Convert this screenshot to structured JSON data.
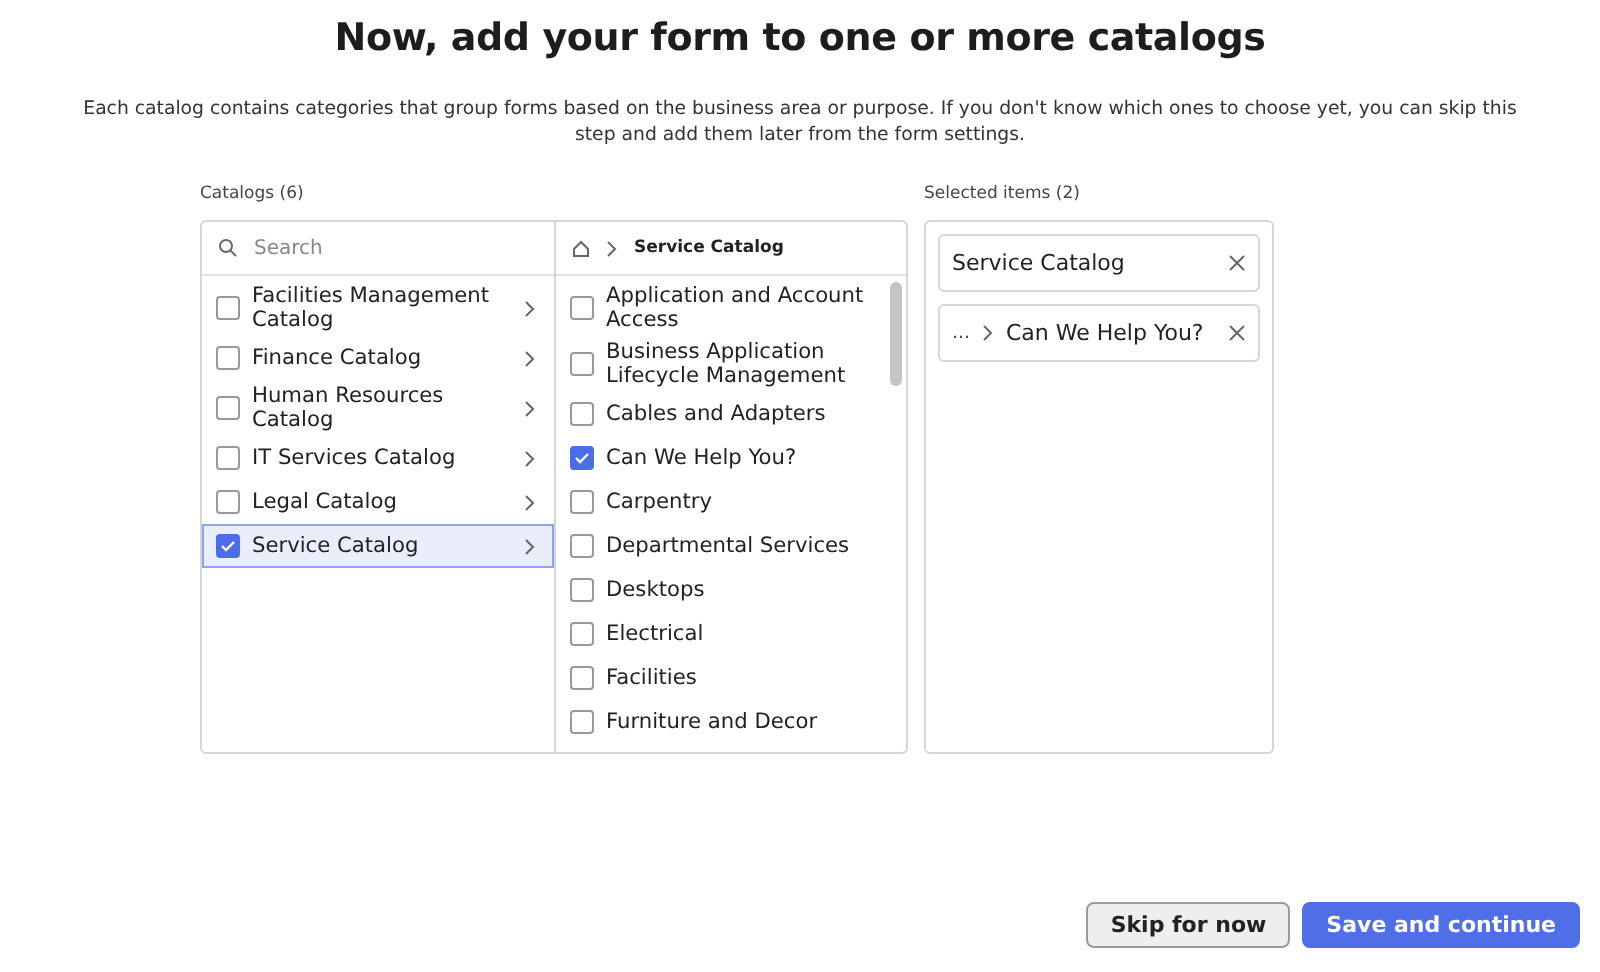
{
  "title": "Now, add your form to one or more catalogs",
  "description": "Each catalog contains categories that group forms based on the business area or purpose. If you don't know which ones to choose yet, you can skip this step and add them later from the form settings.",
  "catalogs": {
    "label": "Catalogs (6)",
    "search": {
      "placeholder": "Search"
    },
    "items": [
      {
        "label": "Facilities Management Catalog",
        "checked": false,
        "selected": false
      },
      {
        "label": "Finance Catalog",
        "checked": false,
        "selected": false
      },
      {
        "label": "Human Resources Catalog",
        "checked": false,
        "selected": false
      },
      {
        "label": "IT Services Catalog",
        "checked": false,
        "selected": false
      },
      {
        "label": "Legal Catalog",
        "checked": false,
        "selected": false
      },
      {
        "label": "Service Catalog",
        "checked": true,
        "selected": true
      }
    ]
  },
  "categories": {
    "breadcrumb": "Service Catalog",
    "items": [
      {
        "label": "Application and Account Access",
        "checked": false
      },
      {
        "label": "Business Application Lifecycle Management",
        "checked": false
      },
      {
        "label": "Cables and Adapters",
        "checked": false
      },
      {
        "label": "Can We Help You?",
        "checked": true
      },
      {
        "label": "Carpentry",
        "checked": false
      },
      {
        "label": "Departmental Services",
        "checked": false
      },
      {
        "label": "Desktops",
        "checked": false
      },
      {
        "label": "Electrical",
        "checked": false
      },
      {
        "label": "Facilities",
        "checked": false
      },
      {
        "label": "Furniture and Decor",
        "checked": false
      }
    ]
  },
  "selected_items": {
    "label": "Selected items (2)",
    "items": [
      {
        "label": "Service Catalog"
      },
      {
        "prefix": "…",
        "label": "Can We Help You?"
      }
    ]
  },
  "buttons": [
    {
      "label": "Skip for now",
      "kind": "secondary"
    },
    {
      "label": "Save and continue",
      "kind": "primary"
    }
  ]
}
